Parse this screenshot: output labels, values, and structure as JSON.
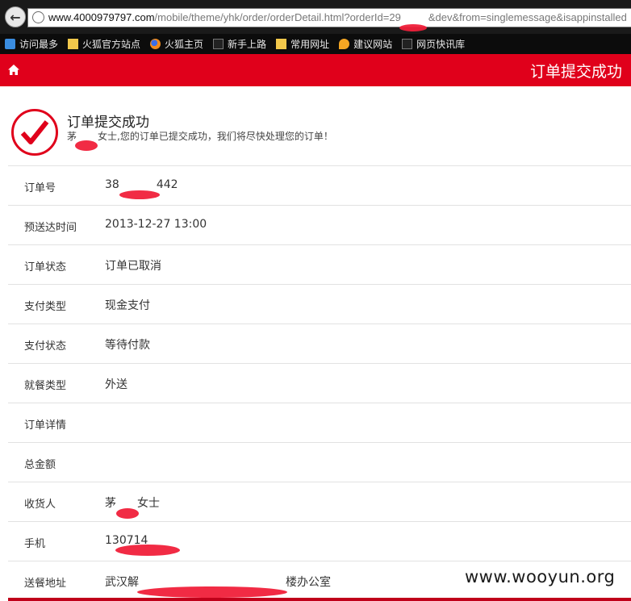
{
  "browser": {
    "url_host": "www.4000979797.com",
    "url_path": "/mobile/theme/yhk/order/orderDetail.html?orderId=29",
    "url_tail": "&dev&from=singlemessage&isappinstalled",
    "bookmarks": [
      {
        "label": "访问最多",
        "icon": "visited-icon"
      },
      {
        "label": "火狐官方站点",
        "icon": "folder-icon"
      },
      {
        "label": "火狐主页",
        "icon": "firefox-icon"
      },
      {
        "label": "新手上路",
        "icon": "page-icon"
      },
      {
        "label": "常用网址",
        "icon": "folder-icon"
      },
      {
        "label": "建议网站",
        "icon": "suggest-icon"
      },
      {
        "label": "网页快讯库",
        "icon": "page-icon"
      }
    ]
  },
  "header": {
    "title": "订单提交成功",
    "color": "#e0001b"
  },
  "success": {
    "title": "订单提交成功",
    "name_prefix": "茅",
    "message": "女士,您的订单已提交成功，我们将尽快处理您的订单！"
  },
  "order": {
    "order_no_label": "订单号",
    "order_no_head": "38",
    "order_no_tail": "442",
    "eta_label": "预送达时间",
    "eta": "2013-12-27 13:00",
    "status_label": "订单状态",
    "status": "订单已取消",
    "pay_type_label": "支付类型",
    "pay_type": "现金支付",
    "pay_status_label": "支付状态",
    "pay_status": "等待付款",
    "dining_type_label": "就餐类型",
    "dining_type": "外送",
    "detail_label": "订单详情",
    "total_label": "总金额",
    "receiver_label": "收货人",
    "receiver_head": "茅",
    "receiver_tail": "女士",
    "phone_label": "手机",
    "phone_head": "130714",
    "address_label": "送餐地址",
    "address_head": "武汉解",
    "address_tail": "楼办公室"
  },
  "watermark": "www.wooyun.org"
}
